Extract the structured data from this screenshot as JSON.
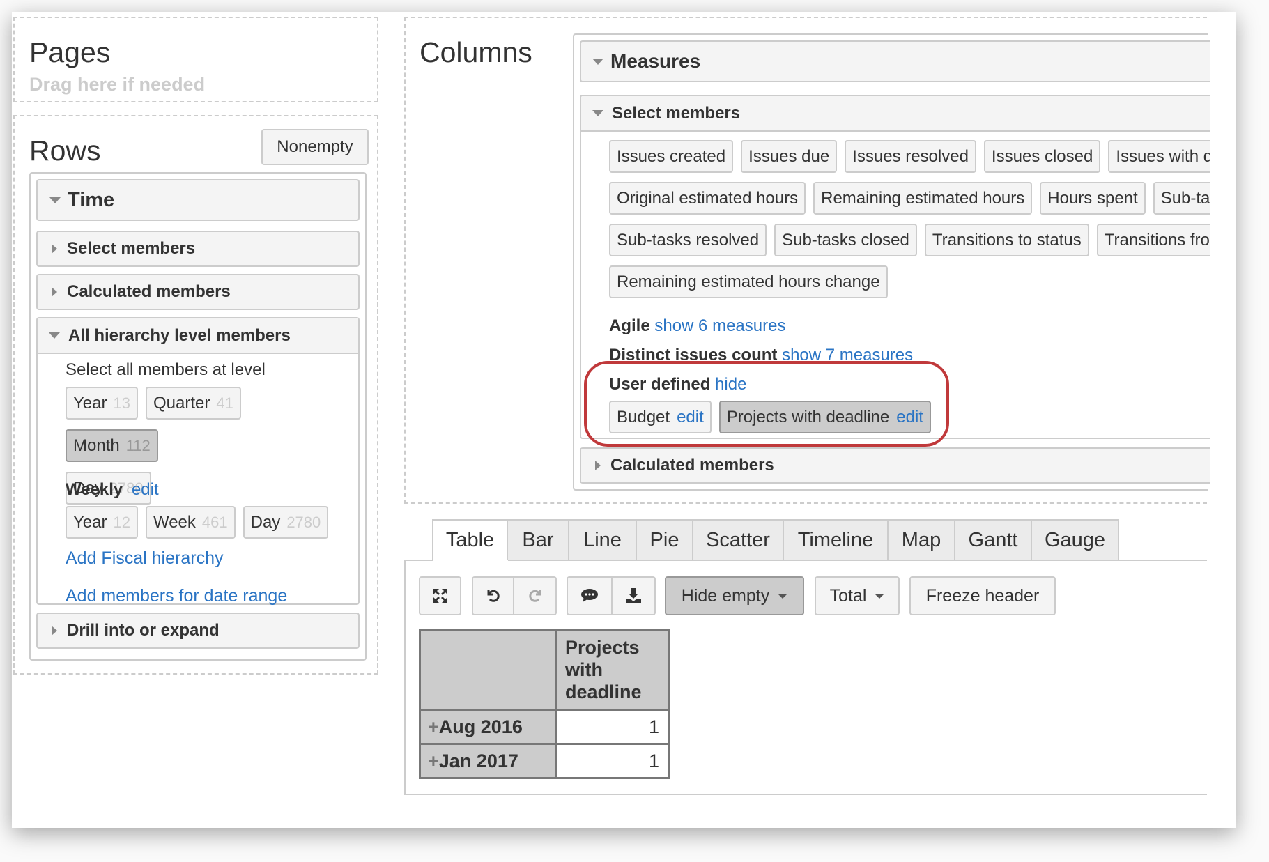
{
  "pages": {
    "title": "Pages",
    "hint": "Drag here if needed"
  },
  "rows": {
    "title": "Rows",
    "nonempty_button": "Nonempty",
    "dimension": "Time",
    "sections": {
      "select_members": "Select members",
      "calculated_members": "Calculated members",
      "all_levels": "All hierarchy level members",
      "drill": "Drill into or expand"
    },
    "select_all_label": "Select all members at level",
    "levels": [
      {
        "label": "Year",
        "count": "13",
        "selected": false
      },
      {
        "label": "Quarter",
        "count": "41",
        "selected": false
      },
      {
        "label": "Month",
        "count": "112",
        "selected": true
      },
      {
        "label": "Day",
        "count": "2780",
        "selected": false
      }
    ],
    "weekly": {
      "label": "Weekly",
      "edit": "edit",
      "levels": [
        {
          "label": "Year",
          "count": "12"
        },
        {
          "label": "Week",
          "count": "461"
        },
        {
          "label": "Day",
          "count": "2780"
        }
      ]
    },
    "add_fiscal": "Add Fiscal hierarchy",
    "add_date_range": "Add members for date range"
  },
  "columns": {
    "title": "Columns",
    "dimension": "Measures",
    "select_members": "Select members",
    "measures": [
      [
        "Issues created",
        "Issues due",
        "Issues resolved",
        "Issues closed",
        "Issues with d"
      ],
      [
        "Original estimated hours",
        "Remaining estimated hours",
        "Hours spent",
        "Sub-tas"
      ],
      [
        "Sub-tasks resolved",
        "Sub-tasks closed",
        "Transitions to status",
        "Transitions fro"
      ],
      [
        "Remaining estimated hours change"
      ]
    ],
    "agile": {
      "label": "Agile",
      "link": "show 6 measures"
    },
    "distinct": {
      "label": "Distinct issues count",
      "link": "show 7 measures"
    },
    "user_defined": {
      "label": "User defined",
      "link": "hide",
      "items": [
        {
          "label": "Budget",
          "edit": "edit",
          "selected": false
        },
        {
          "label": "Projects with deadline",
          "edit": "edit",
          "selected": true
        }
      ]
    },
    "calculated_members": "Calculated members",
    "highlight_color": "#c0393b"
  },
  "tabs": [
    "Table",
    "Bar",
    "Line",
    "Pie",
    "Scatter",
    "Timeline",
    "Map",
    "Gantt",
    "Gauge"
  ],
  "active_tab": "Table",
  "toolbar": {
    "hide_empty": "Hide empty",
    "total": "Total",
    "freeze_header": "Freeze header"
  },
  "table": {
    "column_header": "Projects with deadline",
    "rows": [
      {
        "label": "Aug 2016",
        "value": "1"
      },
      {
        "label": "Jan 2017",
        "value": "1"
      }
    ]
  }
}
